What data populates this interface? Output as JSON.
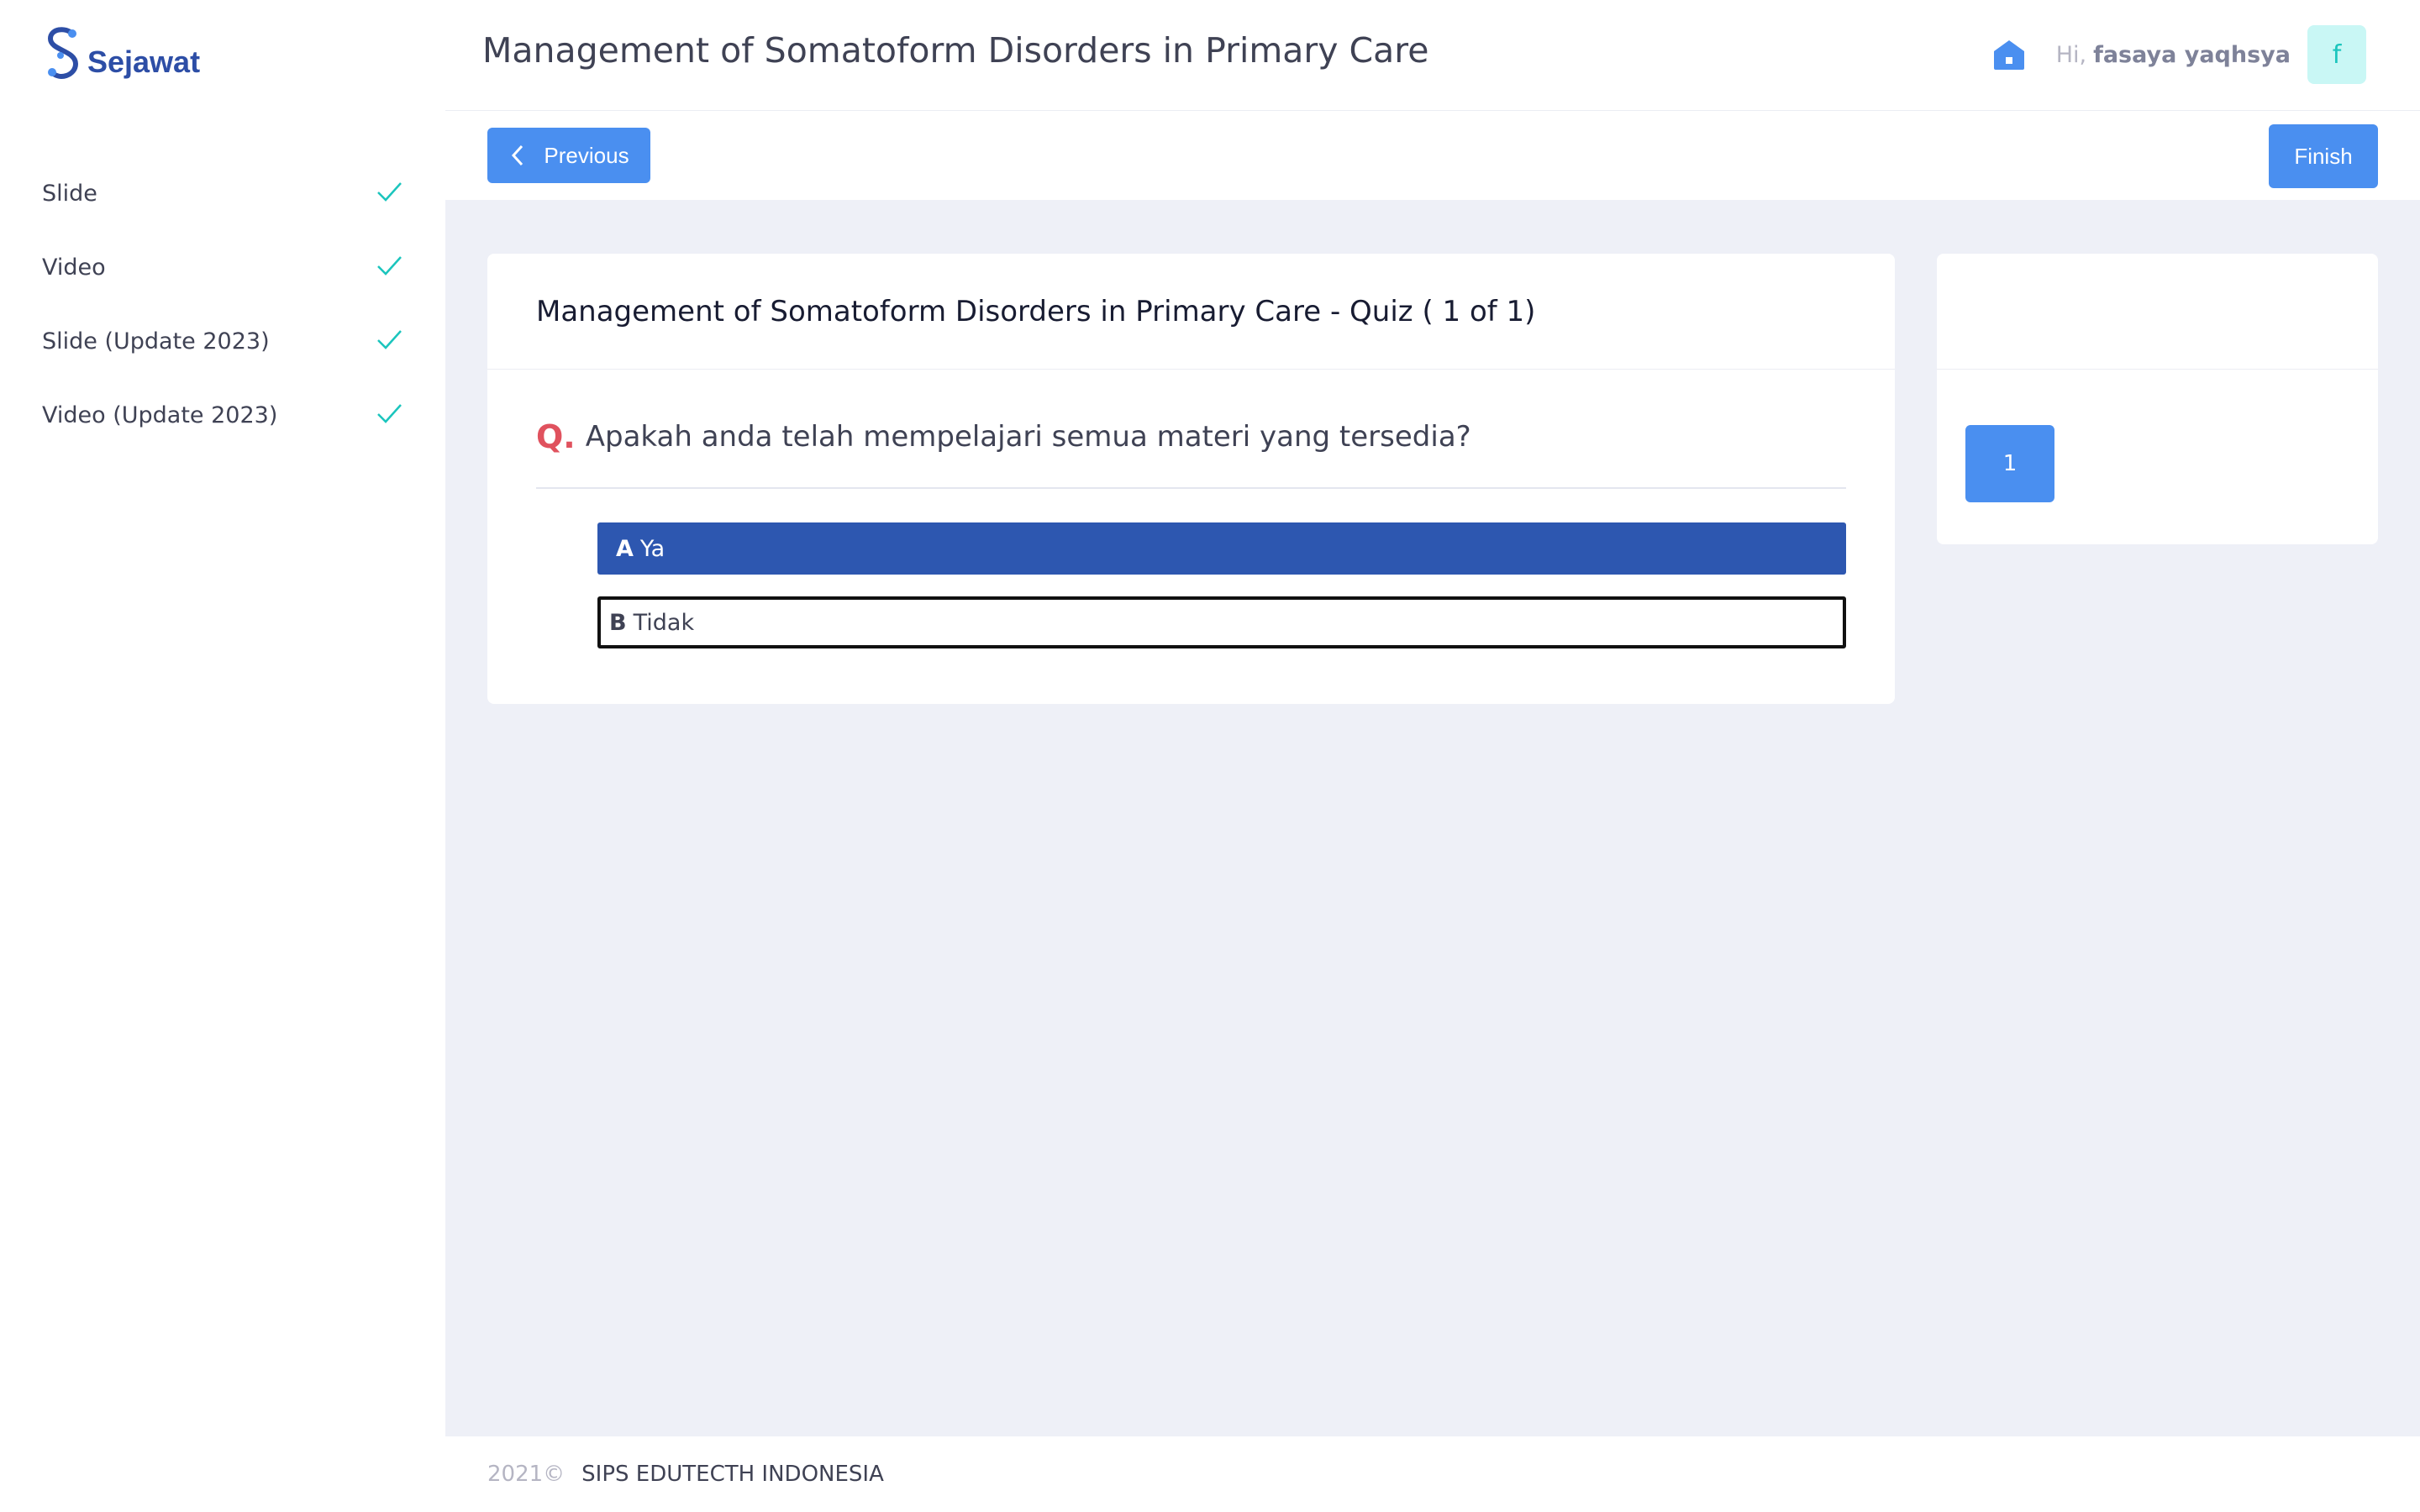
{
  "brand": {
    "name": "Sejawat"
  },
  "sidebar": {
    "items": [
      {
        "label": "Slide"
      },
      {
        "label": "Video"
      },
      {
        "label": "Slide (Update 2023)"
      },
      {
        "label": "Video (Update 2023)"
      }
    ]
  },
  "header": {
    "title": "Management of Somatoform Disorders in Primary Care",
    "greeting": "Hi,",
    "user_name": "fasaya yaqhsya",
    "avatar_initial": "f"
  },
  "toolbar": {
    "previous_label": "Previous",
    "finish_label": "Finish"
  },
  "quiz": {
    "title": "Management of Somatoform Disorders in Primary Care - Quiz ( 1  of 1)",
    "question_marker": "Q.",
    "question": "Apakah anda telah mempelajari semua materi yang tersedia?",
    "options": [
      {
        "letter": "A",
        "text": "Ya",
        "selected": true
      },
      {
        "letter": "B",
        "text": "Tidak",
        "selected": false
      }
    ]
  },
  "navigator": {
    "numbers": [
      "1"
    ]
  },
  "footer": {
    "year": "2021©",
    "org": "SIPS EDUTECTH INDONESIA"
  },
  "colors": {
    "primary": "#4a8ff0",
    "selected_option": "#2d57b0",
    "check": "#1bc5bd",
    "question_marker": "#e0525e"
  }
}
